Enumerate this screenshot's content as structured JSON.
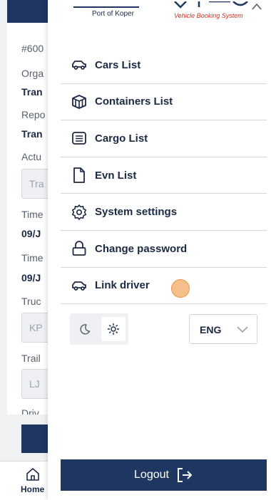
{
  "background": {
    "id_partial": "#600",
    "fields": [
      {
        "label": "Orga",
        "value": "Tran"
      },
      {
        "label": "Repo",
        "value": "Tran"
      },
      {
        "label": "Actu",
        "input": "Tra"
      },
      {
        "label": "Time",
        "value": "09/J"
      },
      {
        "label": "Time",
        "value": "09/J"
      },
      {
        "label": "Truc",
        "input": "KP"
      },
      {
        "label": "Trail",
        "input": "LJ"
      },
      {
        "label": "Driv"
      }
    ],
    "nav": {
      "home_label": "Home"
    }
  },
  "drawer": {
    "logo_left": "Port of Koper",
    "logo_right": "Vehicle Booking System",
    "menu": [
      {
        "icon": "car-icon",
        "label": "Cars List"
      },
      {
        "icon": "container-icon",
        "label": "Containers List"
      },
      {
        "icon": "cargo-icon",
        "label": "Cargo List"
      },
      {
        "icon": "document-icon",
        "label": "Evn List"
      },
      {
        "icon": "gear-icon",
        "label": "System settings"
      },
      {
        "icon": "lock-icon",
        "label": "Change password"
      },
      {
        "icon": "car-icon",
        "label": "Link driver"
      }
    ],
    "theme": {
      "selected": "light"
    },
    "language": {
      "selected": "ENG"
    },
    "logout_label": "Logout"
  },
  "colors": {
    "brand": "#1e3660",
    "divider": "#d4d8de"
  }
}
